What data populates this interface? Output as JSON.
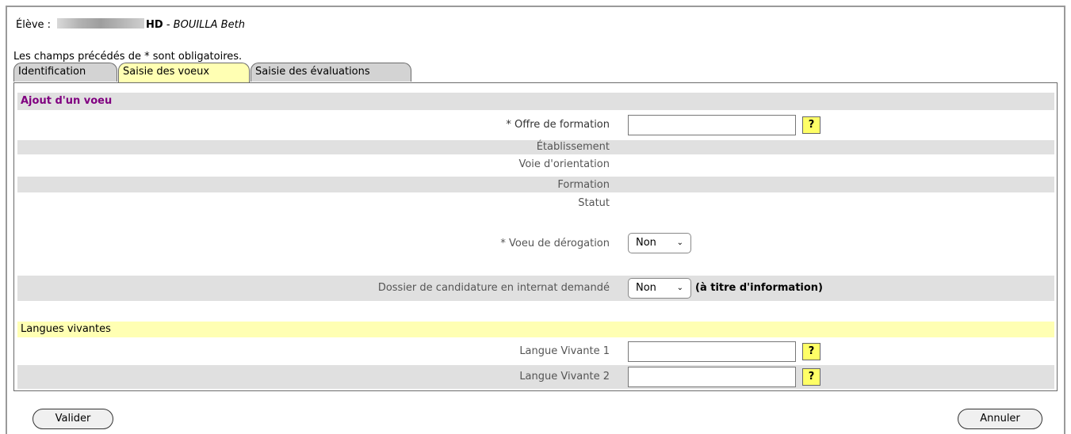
{
  "student": {
    "prefix": "Élève :",
    "code_suffix": "HD",
    "separator": " - ",
    "name": "BOUILLA Beth"
  },
  "required_notice": "Les champs précédés de * sont obligatoires.",
  "tabs": [
    {
      "label": "Identification",
      "active": false
    },
    {
      "label": "Saisie des voeux",
      "active": true
    },
    {
      "label": "Saisie des évaluations",
      "active": false
    }
  ],
  "form": {
    "section_title": "Ajout d'un voeu",
    "offre_label": "* Offre de formation",
    "offre_value": "",
    "help_label": "?",
    "etablissement_label": "Établissement",
    "voie_label": "Voie d'orientation",
    "formation_label": "Formation",
    "statut_label": "Statut",
    "derogation_label": "* Voeu de dérogation",
    "derogation_value": "Non",
    "internat_label": "Dossier de candidature en internat demandé",
    "internat_value": "Non",
    "internat_note": "(à titre d'information)",
    "chevron": "⌄"
  },
  "langues": {
    "section_title": "Langues vivantes",
    "lv1_label": "Langue Vivante 1",
    "lv1_value": "",
    "lv2_label": "Langue Vivante 2",
    "lv2_value": ""
  },
  "buttons": {
    "validate": "Valider",
    "cancel": "Annuler"
  },
  "colors": {
    "active_tab": "#ffffb3",
    "section_title": "#800080",
    "help_button": "#ffff66",
    "row_grey": "#e0e0e0"
  }
}
